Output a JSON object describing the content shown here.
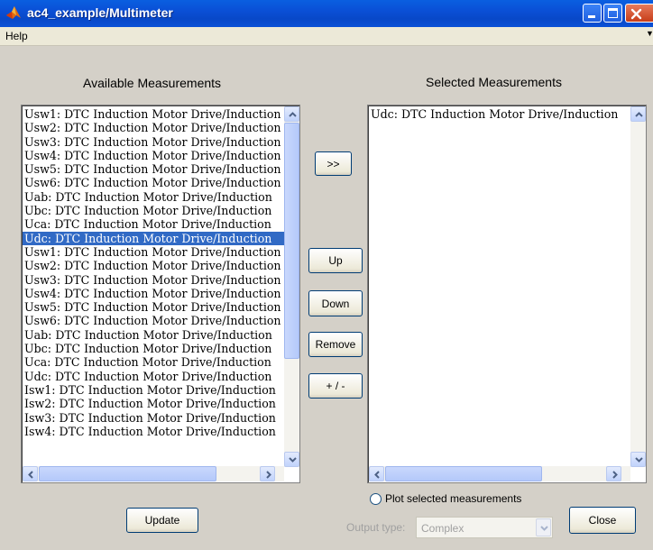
{
  "window": {
    "title": "ac4_example/Multimeter"
  },
  "menu": {
    "help": "Help"
  },
  "available": {
    "heading": "Available Measurements",
    "items": [
      "Usw1: DTC Induction Motor Drive/Induction",
      "Usw2: DTC Induction Motor Drive/Induction",
      "Usw3: DTC Induction Motor Drive/Induction",
      "Usw4: DTC Induction Motor Drive/Induction",
      "Usw5: DTC Induction Motor Drive/Induction",
      "Usw6: DTC Induction Motor Drive/Induction",
      "Uab: DTC Induction Motor Drive/Induction",
      "Ubc: DTC Induction Motor Drive/Induction",
      "Uca: DTC Induction Motor Drive/Induction",
      "Udc: DTC Induction Motor Drive/Induction",
      "Usw1: DTC Induction Motor Drive/Induction",
      "Usw2: DTC Induction Motor Drive/Induction",
      "Usw3: DTC Induction Motor Drive/Induction",
      "Usw4: DTC Induction Motor Drive/Induction",
      "Usw5: DTC Induction Motor Drive/Induction",
      "Usw6: DTC Induction Motor Drive/Induction",
      "Uab: DTC Induction Motor Drive/Induction",
      "Ubc: DTC Induction Motor Drive/Induction",
      "Uca: DTC Induction Motor Drive/Induction",
      "Udc: DTC Induction Motor Drive/Induction",
      "Isw1: DTC Induction Motor Drive/Induction",
      "Isw2: DTC Induction Motor Drive/Induction",
      "Isw3: DTC Induction Motor Drive/Induction",
      "Isw4: DTC Induction Motor Drive/Induction"
    ],
    "selected_index": 9
  },
  "selected": {
    "heading": "Selected Measurements",
    "items": [
      "Udc: DTC Induction Motor Drive/Induction"
    ]
  },
  "buttons": {
    "add": ">>",
    "up": "Up",
    "down": "Down",
    "remove": "Remove",
    "sign": "+ / -",
    "update": "Update",
    "close": "Close"
  },
  "plot": {
    "label": "Plot selected measurements",
    "checked": false
  },
  "output": {
    "label": "Output type:",
    "value": "Complex",
    "enabled": false
  },
  "icons": {
    "app": "matlab-icon",
    "minimize": "minimize-icon",
    "maximize": "maximize-icon",
    "close": "close-icon"
  },
  "colors": {
    "selection": "#316ac5",
    "titlebar": "#0a4fd6"
  }
}
